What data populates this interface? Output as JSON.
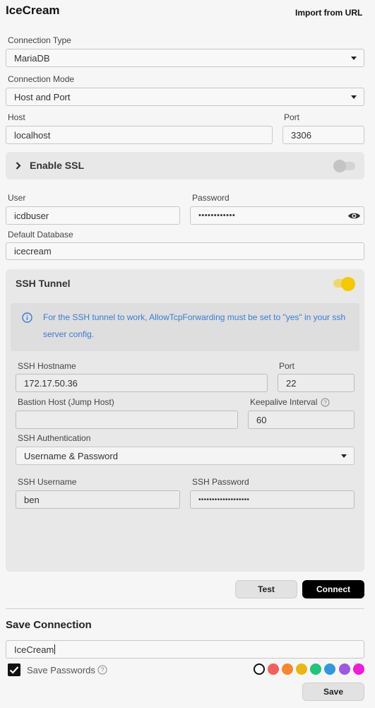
{
  "header": {
    "title": "IceCream",
    "import_label": "Import from URL"
  },
  "connection": {
    "type_label": "Connection Type",
    "type_value": "MariaDB",
    "mode_label": "Connection Mode",
    "mode_value": "Host and Port",
    "host_label": "Host",
    "host_value": "localhost",
    "port_label": "Port",
    "port_value": "3306",
    "user_label": "User",
    "user_value": "icdbuser",
    "password_label": "Password",
    "password_value": "••••••••••••",
    "default_db_label": "Default Database",
    "default_db_value": "icecream"
  },
  "ssl": {
    "label": "Enable SSL",
    "enabled": false
  },
  "ssh": {
    "title": "SSH Tunnel",
    "enabled": true,
    "info": "For the SSH tunnel to work, AllowTcpForwarding must be set to \"yes\" in your ssh server config.",
    "hostname_label": "SSH Hostname",
    "hostname_value": "172.17.50.36",
    "port_label": "Port",
    "port_value": "22",
    "bastion_label": "Bastion Host (Jump Host)",
    "bastion_value": "",
    "keepalive_label": "Keepalive Interval",
    "keepalive_value": "60",
    "auth_label": "SSH Authentication",
    "auth_value": "Username & Password",
    "username_label": "SSH Username",
    "username_value": "ben",
    "password_label": "SSH Password",
    "password_value": "•••••••••••••••••••"
  },
  "actions": {
    "test_label": "Test",
    "connect_label": "Connect"
  },
  "save": {
    "title": "Save Connection",
    "name_value": "IceCream",
    "save_passwords_label": "Save Passwords",
    "save_passwords_checked": true,
    "save_label": "Save",
    "colors": [
      "#ffffff",
      "#f25f5c",
      "#f7872b",
      "#e8b810",
      "#1fc57d",
      "#3196e0",
      "#9b59e6",
      "#f01ad8"
    ],
    "accent": "#f5c800"
  }
}
